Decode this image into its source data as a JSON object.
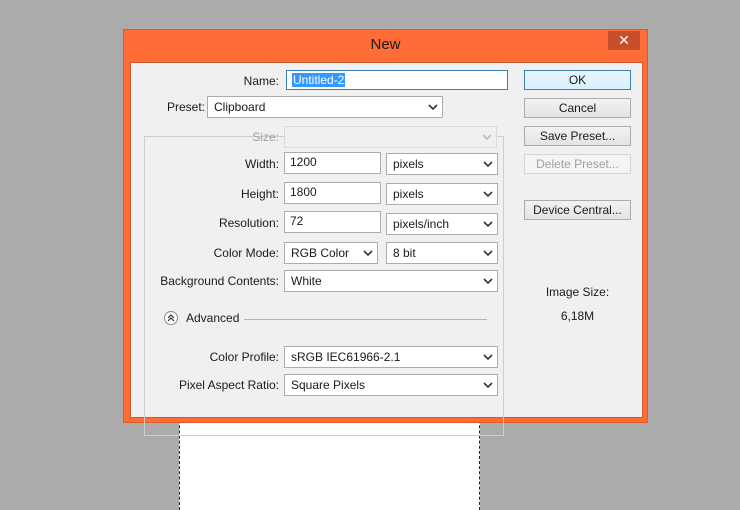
{
  "dialog": {
    "title": "New",
    "close_glyph": "✕"
  },
  "form": {
    "name": {
      "label": "Name:",
      "value": "Untitled-2"
    },
    "preset": {
      "label": "Preset:",
      "value": "Clipboard"
    },
    "size": {
      "label": "Size:",
      "value": ""
    },
    "width": {
      "label": "Width:",
      "value": "1200",
      "unit": "pixels"
    },
    "height": {
      "label": "Height:",
      "value": "1800",
      "unit": "pixels"
    },
    "resolution": {
      "label": "Resolution:",
      "value": "72",
      "unit": "pixels/inch"
    },
    "color_mode": {
      "label": "Color Mode:",
      "value": "RGB Color",
      "bit_depth": "8 bit"
    },
    "background": {
      "label": "Background Contents:",
      "value": "White"
    },
    "advanced": {
      "label": "Advanced"
    },
    "color_profile": {
      "label": "Color Profile:",
      "value": "sRGB IEC61966-2.1"
    },
    "pixel_aspect": {
      "label": "Pixel Aspect Ratio:",
      "value": "Square Pixels"
    }
  },
  "buttons": {
    "ok": "OK",
    "cancel": "Cancel",
    "save_preset": "Save Preset...",
    "delete_preset": "Delete Preset...",
    "device_central": "Device Central..."
  },
  "image_size": {
    "label": "Image Size:",
    "value": "6,18M"
  },
  "colors": {
    "title_bar": "#ff6c35",
    "background": "#ababab",
    "selection": "#3399ff"
  },
  "icons": {
    "dropdown": "chevron-down-icon",
    "close": "close-icon",
    "advanced": "double-chevron-up-icon"
  }
}
